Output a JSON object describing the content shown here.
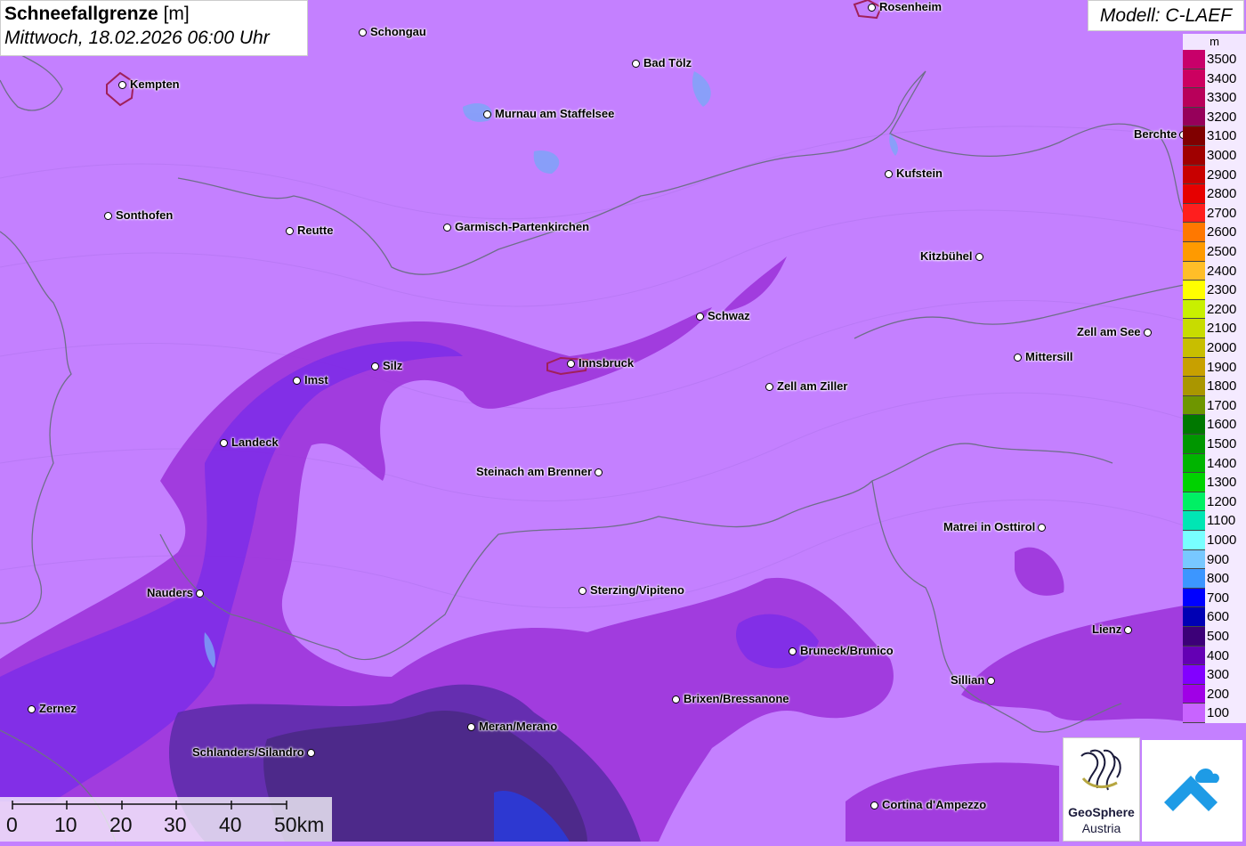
{
  "header": {
    "title_bold": "Schneefallgrenze",
    "title_unit": "[m]",
    "subtitle": "Mittwoch, 18.02.2026 06:00 Uhr",
    "model": "Modell: C-LAEF"
  },
  "legend": {
    "unit": "m",
    "steps": [
      {
        "label": "3500",
        "color": "#c8006a"
      },
      {
        "label": "3400",
        "color": "#cc0060"
      },
      {
        "label": "3300",
        "color": "#b8005a"
      },
      {
        "label": "3200",
        "color": "#96005a"
      },
      {
        "label": "3100",
        "color": "#800000"
      },
      {
        "label": "3000",
        "color": "#a00000"
      },
      {
        "label": "2900",
        "color": "#c80000"
      },
      {
        "label": "2800",
        "color": "#e60000"
      },
      {
        "label": "2700",
        "color": "#ff1e1e"
      },
      {
        "label": "2600",
        "color": "#ff7800"
      },
      {
        "label": "2500",
        "color": "#ff9a00"
      },
      {
        "label": "2400",
        "color": "#ffbe28"
      },
      {
        "label": "2300",
        "color": "#ffff00"
      },
      {
        "label": "2200",
        "color": "#c8f000"
      },
      {
        "label": "2100",
        "color": "#c8dc00"
      },
      {
        "label": "2000",
        "color": "#c8be00"
      },
      {
        "label": "1900",
        "color": "#c8a000"
      },
      {
        "label": "1800",
        "color": "#aa9600"
      },
      {
        "label": "1700",
        "color": "#6e9600"
      },
      {
        "label": "1600",
        "color": "#007800"
      },
      {
        "label": "1500",
        "color": "#009600"
      },
      {
        "label": "1400",
        "color": "#00b400"
      },
      {
        "label": "1300",
        "color": "#00d200"
      },
      {
        "label": "1200",
        "color": "#00f064"
      },
      {
        "label": "1100",
        "color": "#00e6b4"
      },
      {
        "label": "1000",
        "color": "#78ffff"
      },
      {
        "label": "900",
        "color": "#78c8ff"
      },
      {
        "label": "800",
        "color": "#3c96ff"
      },
      {
        "label": "700",
        "color": "#0000ff"
      },
      {
        "label": "600",
        "color": "#0000b4"
      },
      {
        "label": "500",
        "color": "#3c0078"
      },
      {
        "label": "400",
        "color": "#6400b4"
      },
      {
        "label": "300",
        "color": "#8200ff"
      },
      {
        "label": "200",
        "color": "#a000e6"
      },
      {
        "label": "100",
        "color": "#c864ff"
      }
    ]
  },
  "cities": [
    {
      "name": "Rosenheim",
      "side": "right"
    },
    {
      "name": "Schongau",
      "side": "right"
    },
    {
      "name": "Kempten",
      "side": "right"
    },
    {
      "name": "Bad Tölz",
      "side": "right"
    },
    {
      "name": "Murnau am Staffelsee",
      "side": "right"
    },
    {
      "name": "Kufstein",
      "side": "right"
    },
    {
      "name": "Berchte",
      "side": "left"
    },
    {
      "name": "Sonthofen",
      "side": "right"
    },
    {
      "name": "Reutte",
      "side": "right"
    },
    {
      "name": "Garmisch-Partenkirchen",
      "side": "right"
    },
    {
      "name": "Kitzbühel",
      "side": "left"
    },
    {
      "name": "Schwaz",
      "side": "right"
    },
    {
      "name": "Zell am See",
      "side": "left"
    },
    {
      "name": "Imst",
      "side": "right"
    },
    {
      "name": "Silz",
      "side": "right"
    },
    {
      "name": "Innsbruck",
      "side": "right"
    },
    {
      "name": "Mittersill",
      "side": "right"
    },
    {
      "name": "Zell am Ziller",
      "side": "right"
    },
    {
      "name": "Landeck",
      "side": "right"
    },
    {
      "name": "Steinach am Brenner",
      "side": "left"
    },
    {
      "name": "Matrei in Osttirol",
      "side": "left"
    },
    {
      "name": "Nauders",
      "side": "left"
    },
    {
      "name": "Sterzing/Vipiteno",
      "side": "right"
    },
    {
      "name": "Lienz",
      "side": "left"
    },
    {
      "name": "Bruneck/Brunico",
      "side": "right"
    },
    {
      "name": "Sillian",
      "side": "left"
    },
    {
      "name": "Zernez",
      "side": "right"
    },
    {
      "name": "Brixen/Bressanone",
      "side": "right"
    },
    {
      "name": "Meran/Merano",
      "side": "right"
    },
    {
      "name": "Schlanders/Silandro",
      "side": "left"
    },
    {
      "name": "Cortina d'Ampezzo",
      "side": "right"
    }
  ],
  "scale": {
    "labels": [
      "0",
      "10",
      "20",
      "30",
      "40",
      "50km"
    ]
  },
  "logos": {
    "geosphere_line1": "GeoSphere",
    "geosphere_line2": "Austria",
    "accent": "#1e9be6"
  }
}
